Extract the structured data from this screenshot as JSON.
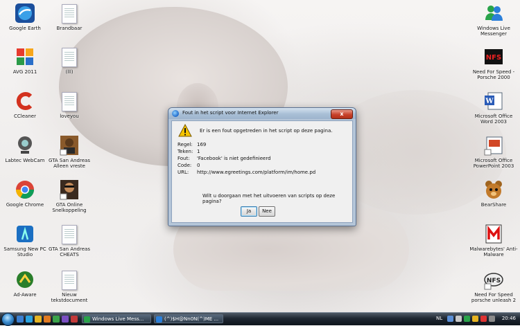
{
  "desktop_icons_left": [
    {
      "label": "Google Earth",
      "icon": "google-earth-icon"
    },
    {
      "label": "AVG 2011",
      "icon": "avg-icon"
    },
    {
      "label": "CCleaner",
      "icon": "ccleaner-icon"
    },
    {
      "label": "Labtec WebCam",
      "icon": "webcam-icon"
    },
    {
      "label": "Google Chrome",
      "icon": "chrome-icon"
    },
    {
      "label": "Samsung New PC Studio",
      "icon": "samsung-icon"
    },
    {
      "label": "Ad-Aware",
      "icon": "adaware-icon"
    }
  ],
  "desktop_icons_mid": [
    {
      "label": "Brandbaar",
      "icon": "text-document-icon"
    },
    {
      "label": "(lll)",
      "icon": "text-document-icon"
    },
    {
      "label": "loveyou",
      "icon": "text-document-icon"
    },
    {
      "label": "GTA San Andreas Alleen vreste",
      "icon": "gta-icon"
    },
    {
      "label": "GTA Online Snelkoppeling",
      "icon": "gta-online-icon"
    },
    {
      "label": "GTA San Andreas CHEATS",
      "icon": "text-document-icon"
    },
    {
      "label": "Nieuw tekstdocument",
      "icon": "text-document-icon"
    }
  ],
  "desktop_icons_right": [
    {
      "label": "Windows Live Messenger",
      "icon": "messenger-icon"
    },
    {
      "label": "Need For Speed - Porsche 2000",
      "icon": "nfs-icon"
    },
    {
      "label": "Microsoft Office Word 2003",
      "icon": "word-icon"
    },
    {
      "label": "Microsoft Office PowerPoint 2003",
      "icon": "powerpoint-icon"
    },
    {
      "label": "BearShare",
      "icon": "bearshare-icon"
    },
    {
      "label": "Malwarebytes' Anti-Malware",
      "icon": "malwarebytes-icon"
    },
    {
      "label": "Need For Speed porsche unleash 2",
      "icon": "nfs-unleashed-icon"
    }
  ],
  "dialog": {
    "title": "Fout in het script voor Internet Explorer",
    "close_label": "x",
    "message": "Er is een fout opgetreden in het script op deze pagina.",
    "details": [
      {
        "key": "Regel:",
        "value": "169"
      },
      {
        "key": "Teken:",
        "value": "1"
      },
      {
        "key": "Fout:",
        "value": "'Facebook' is niet gedefinieerd"
      },
      {
        "key": "Code:",
        "value": "0"
      },
      {
        "key": "URL:",
        "value": "http://www.egreetings.com/platform/im/home.pd"
      }
    ],
    "question": "Wilt u doorgaan met het uitvoeren van scripts op deze pagina?",
    "yes_label": "Ja",
    "no_label": "Nee"
  },
  "taskbar": {
    "tasks": [
      {
        "label": "Windows Live Mess...",
        "icon": "messenger-icon"
      },
      {
        "label": "(^)$H@Nn0N(^)ME ...",
        "icon": "messenger-icon"
      }
    ],
    "language": "NL",
    "time": "20:46"
  },
  "colors": {
    "dialog_frame": "#b4c5d8",
    "taskbar": "#1f2731",
    "warning": "#f5c400"
  }
}
